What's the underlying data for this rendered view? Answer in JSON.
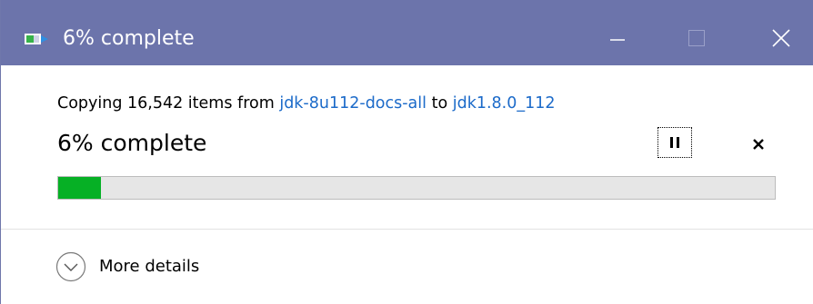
{
  "titlebar": {
    "title": "6% complete",
    "icon": "copy-progress-icon",
    "minimize_icon": "minimize-icon",
    "maximize_icon": "maximize-icon",
    "close_icon": "close-icon",
    "background_color": "#6c74ab"
  },
  "operation": {
    "prefix": "Copying 16,542 items from ",
    "source": "jdk-8u112-docs-all",
    "to_word": " to ",
    "destination": "jdk1.8.0_112",
    "link_color": "#1b6ac9"
  },
  "status": {
    "text": "6% complete",
    "pause_icon": "pause-icon",
    "stop_icon": "stop-icon"
  },
  "progress": {
    "percent": 6,
    "fill_color": "#06b025",
    "track_color": "#e6e6e6"
  },
  "details": {
    "label": "More details",
    "icon": "chevron-down-circle-icon"
  }
}
